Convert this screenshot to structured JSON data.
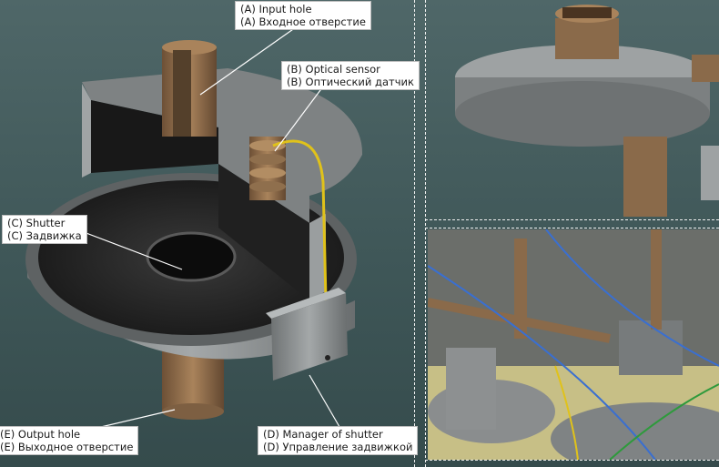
{
  "labels": {
    "input_hole": {
      "en": "(A) Input hole",
      "ru": "(A) Входное отверстие"
    },
    "optical_sensor": {
      "en": "(B) Optical sensor",
      "ru": "(B) Оптический датчик"
    },
    "shutter": {
      "en": "(C) Shutter",
      "ru": "(C) Задвижка"
    },
    "output_hole": {
      "en": "(E) Output hole",
      "ru": "(E) Выходное отверстие"
    },
    "manager_of_shutter": {
      "en": "(D) Manager of  shutter",
      "ru": "(D) Управление задвижкой"
    }
  },
  "colors": {
    "background": "#3f5758",
    "metal": "#8e9293",
    "copper": "#8a6a4a",
    "sensor_wire": "#e0c21a",
    "divider": "#f2f2f2"
  }
}
